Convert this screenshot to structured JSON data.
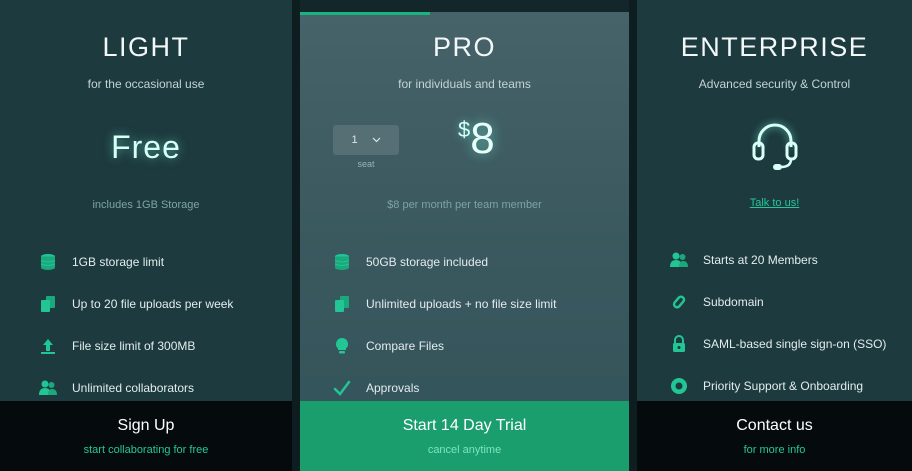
{
  "accent": "#19b47f",
  "plans": {
    "light": {
      "title": "LIGHT",
      "subtitle": "for the occasional use",
      "price_text": "Free",
      "note": "includes 1GB Storage",
      "features": [
        {
          "icon": "database-icon",
          "text": "1GB storage limit"
        },
        {
          "icon": "files-icon",
          "text": "Up to 20 file uploads per week"
        },
        {
          "icon": "upload-icon",
          "text": "File size limit of 300MB"
        },
        {
          "icon": "users-icon",
          "text": "Unlimited collaborators"
        }
      ],
      "cta_title": "Sign Up",
      "cta_sub": "start collaborating for free"
    },
    "pro": {
      "title": "PRO",
      "subtitle": "for individuals and teams",
      "seat_value": "1",
      "seat_label": "seat",
      "currency": "$",
      "price": "8",
      "note": "$8 per month per team member",
      "features": [
        {
          "icon": "database-icon",
          "text": "50GB storage included"
        },
        {
          "icon": "files-icon",
          "text": "Unlimited uploads + no file size limit"
        },
        {
          "icon": "bulb-icon",
          "text": "Compare Files"
        },
        {
          "icon": "check-icon",
          "text": "Approvals"
        }
      ],
      "cta_title": "Start 14 Day Trial",
      "cta_sub": "cancel anytime"
    },
    "enterprise": {
      "title": "ENTERPRISE",
      "subtitle": "Advanced security & Control",
      "link": "Talk to us!",
      "features": [
        {
          "icon": "users-icon",
          "text": "Starts at 20 Members"
        },
        {
          "icon": "link-icon",
          "text": "Subdomain"
        },
        {
          "icon": "lock-icon",
          "text": "SAML-based single sign-on (SSO)"
        },
        {
          "icon": "support-icon",
          "text": "Priority Support & Onboarding"
        }
      ],
      "cta_title": "Contact us",
      "cta_sub": "for more info"
    }
  }
}
